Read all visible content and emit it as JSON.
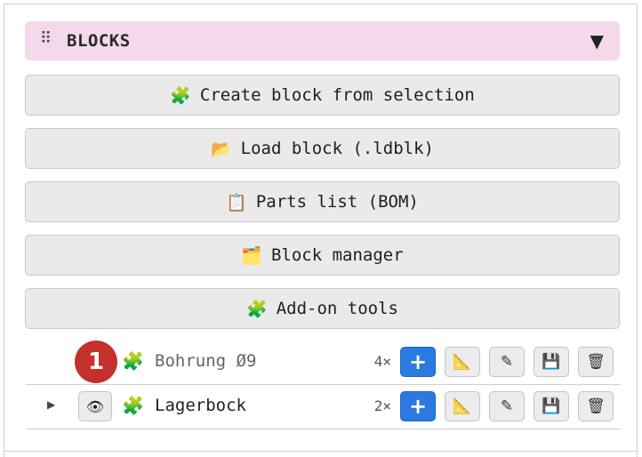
{
  "panel": {
    "title": "BLOCKS",
    "grip_glyph": "⠿",
    "collapse_glyph": "▼"
  },
  "actions": [
    {
      "icon": "🧩",
      "label": "Create block from selection"
    },
    {
      "icon": "📂",
      "label": "Load block (.ldblk)"
    },
    {
      "icon": "📋",
      "label": "Parts list (BOM)"
    },
    {
      "icon": "🗂️",
      "label": "Block manager"
    },
    {
      "icon": "🧩",
      "label": "Add-on tools"
    }
  ],
  "blocks": [
    {
      "badge": "1",
      "icon": "🧩",
      "name": "Bohrung Ø9",
      "count": "4×",
      "tools": {
        "add": "+",
        "measure": "📐",
        "edit": "✎",
        "save": "💾",
        "delete": "🗑"
      }
    },
    {
      "expand": "▶",
      "eye": "👁",
      "icon": "🧩",
      "name": "Lagerbock",
      "count": "2×",
      "tools": {
        "add": "+",
        "measure": "📐",
        "edit": "✎",
        "save": "💾",
        "delete": "🗑"
      }
    }
  ],
  "colors": {
    "header_bg": "#f4d8ec",
    "button_bg": "#eaeaea",
    "primary": "#2a7ae2",
    "badge": "#c4302b"
  }
}
